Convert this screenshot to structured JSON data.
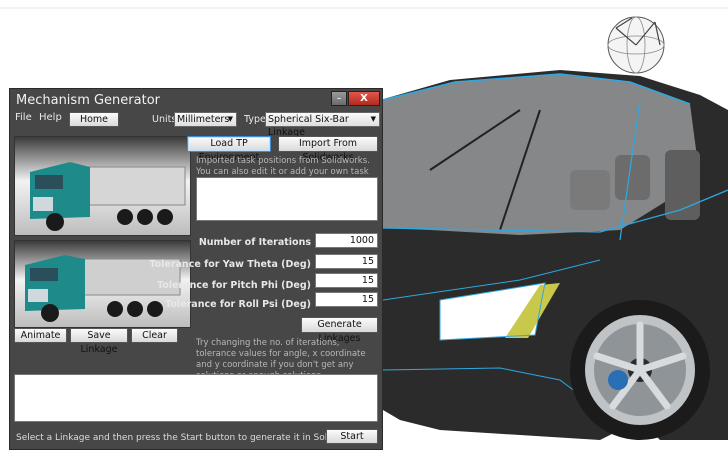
{
  "window": {
    "title": "Mechanism Generator",
    "min_glyph": "–",
    "close_glyph": "X"
  },
  "menu": {
    "file": "File",
    "help": "Help"
  },
  "toolbar": {
    "home": "Home",
    "units_label": "Units",
    "units_value": "Millimeters",
    "type_label": "Type",
    "type_value": "Spherical Six-Bar Linkage"
  },
  "task_positions": {
    "load_button": "Load TP Environment",
    "import_button": "Import From Solidworks",
    "help_text": "Imported task positions from Solidworks. You can also edit it or add your own task positions here."
  },
  "params": [
    {
      "label": "Number of Iterations",
      "value": "1000"
    },
    {
      "label": "Tolerance for Yaw Theta (Deg)",
      "value": "15"
    },
    {
      "label": "Tolerance for Pitch Phi (Deg)",
      "value": "15"
    },
    {
      "label": "Tolerance for Roll Psi (Deg)",
      "value": "15"
    }
  ],
  "generate_button": "Generate Linkages",
  "generate_help": "Try changing the no. of iterations, tolerance values for angle, x coordinate and y coordinate if you don't get any solutions or enough solutions.",
  "actions": {
    "animate": "Animate",
    "save": "Save Linkage",
    "clear": "Clear"
  },
  "status_text": "Select a Linkage and then press the Start button to generate it in Solidworks.",
  "start_button": "Start",
  "colors": {
    "window_bg": "#474747",
    "truck_cab": "#1f8a8a",
    "car_body": "#2b2b2b",
    "accent_edges": "#2fa8e0"
  },
  "icons": [
    "triad-sphere-icon",
    "truck-preview-icon",
    "car-model-icon"
  ]
}
